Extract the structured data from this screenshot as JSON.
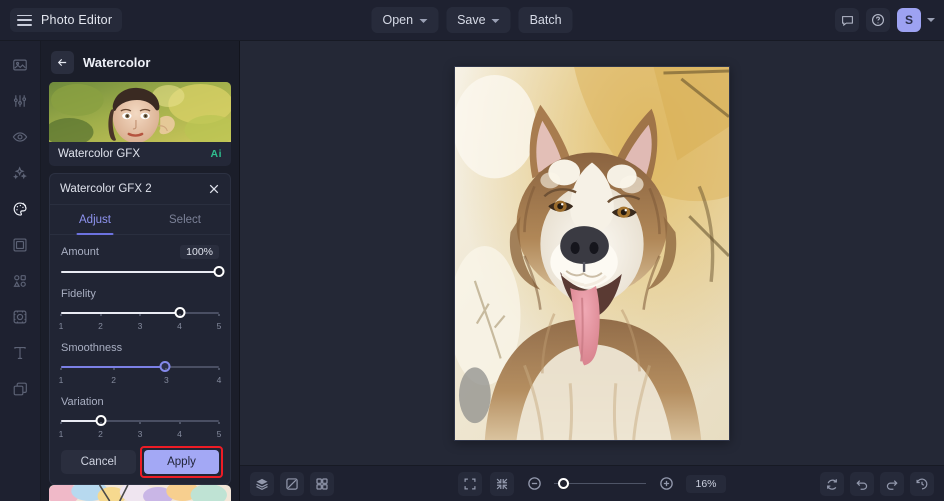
{
  "topbar": {
    "brand": "Photo Editor",
    "menu_icon": "hamburger-icon",
    "buttons": [
      {
        "label": "Open",
        "has_caret": true
      },
      {
        "label": "Save",
        "has_caret": true
      },
      {
        "label": "Batch",
        "has_caret": false
      }
    ],
    "right_icons": [
      "comment-icon",
      "help-icon"
    ],
    "avatar_initial": "S"
  },
  "rail": {
    "items": [
      {
        "name": "image-icon",
        "active": false
      },
      {
        "name": "adjustments-icon",
        "active": false
      },
      {
        "name": "eye-icon",
        "active": false
      },
      {
        "name": "sparkles-icon",
        "active": false
      },
      {
        "name": "palette-icon",
        "active": true
      },
      {
        "name": "frame-icon",
        "active": false
      },
      {
        "name": "shapes-icon",
        "active": false
      },
      {
        "name": "crop-ai-icon",
        "active": false
      },
      {
        "name": "text-icon",
        "active": false
      },
      {
        "name": "layers-icon",
        "active": false
      }
    ]
  },
  "panel": {
    "back_icon": "arrow-left-icon",
    "title": "Watercolor",
    "preset": {
      "label": "Watercolor GFX",
      "badge": "Ai"
    },
    "effect": {
      "title": "Watercolor GFX 2",
      "close_icon": "close-icon",
      "tabs": [
        {
          "label": "Adjust",
          "active": true
        },
        {
          "label": "Select",
          "active": false
        }
      ],
      "controls": [
        {
          "label": "Amount",
          "value_text": "100%",
          "percent": 100,
          "accent": false,
          "ticks": []
        },
        {
          "label": "Fidelity",
          "value_text": "",
          "percent": 75,
          "accent": false,
          "ticks": [
            "1",
            "2",
            "3",
            "4",
            "5"
          ]
        },
        {
          "label": "Smoothness",
          "value_text": "",
          "percent": 66,
          "accent": true,
          "ticks": [
            "1",
            "2",
            "3",
            "4"
          ]
        },
        {
          "label": "Variation",
          "value_text": "",
          "percent": 25,
          "accent": false,
          "ticks": [
            "1",
            "2",
            "3",
            "4",
            "5"
          ]
        }
      ],
      "cancel_label": "Cancel",
      "apply_label": "Apply",
      "apply_highlighted": true
    }
  },
  "bottombar": {
    "left_icons": [
      "layers-stack-icon",
      "compare-icon",
      "grid-icon"
    ],
    "center_icons": [
      "fit-screen-icon",
      "collapse-icon"
    ],
    "zoom_out_icon": "zoom-out-icon",
    "zoom_in_icon": "zoom-in-icon",
    "zoom_level": "16%",
    "zoom_percent": 4,
    "right_icons": [
      "reset-icon",
      "undo-icon",
      "redo-icon",
      "history-icon"
    ]
  },
  "colors": {
    "accent": "#7b80e6",
    "apply_bg": "#a3a8f5",
    "highlight": "#ee1c25",
    "ai_badge": "#2fbf8f"
  }
}
